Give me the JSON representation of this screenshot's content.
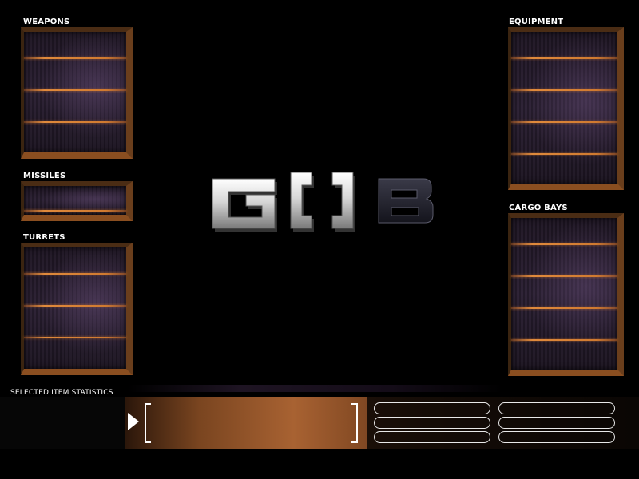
{
  "panels": {
    "weapons": {
      "label": "WEAPONS"
    },
    "missiles": {
      "label": "MISSILES"
    },
    "turrets": {
      "label": "TURRETS"
    },
    "equipment": {
      "label": "EQUIPMENT"
    },
    "cargo_bays": {
      "label": "CARGO BAYS"
    }
  },
  "stats": {
    "title": "SELECTED ITEM STATISTICS",
    "left_column_fields": [
      "",
      "",
      ""
    ],
    "right_column_fields": [
      "",
      "",
      ""
    ]
  },
  "logo": {
    "icon": "gob-logo"
  },
  "colors": {
    "accent_orange": "#e08a3c",
    "panel_purple": "#2b2033",
    "copper": "#a86232",
    "text": "#ffffff"
  }
}
